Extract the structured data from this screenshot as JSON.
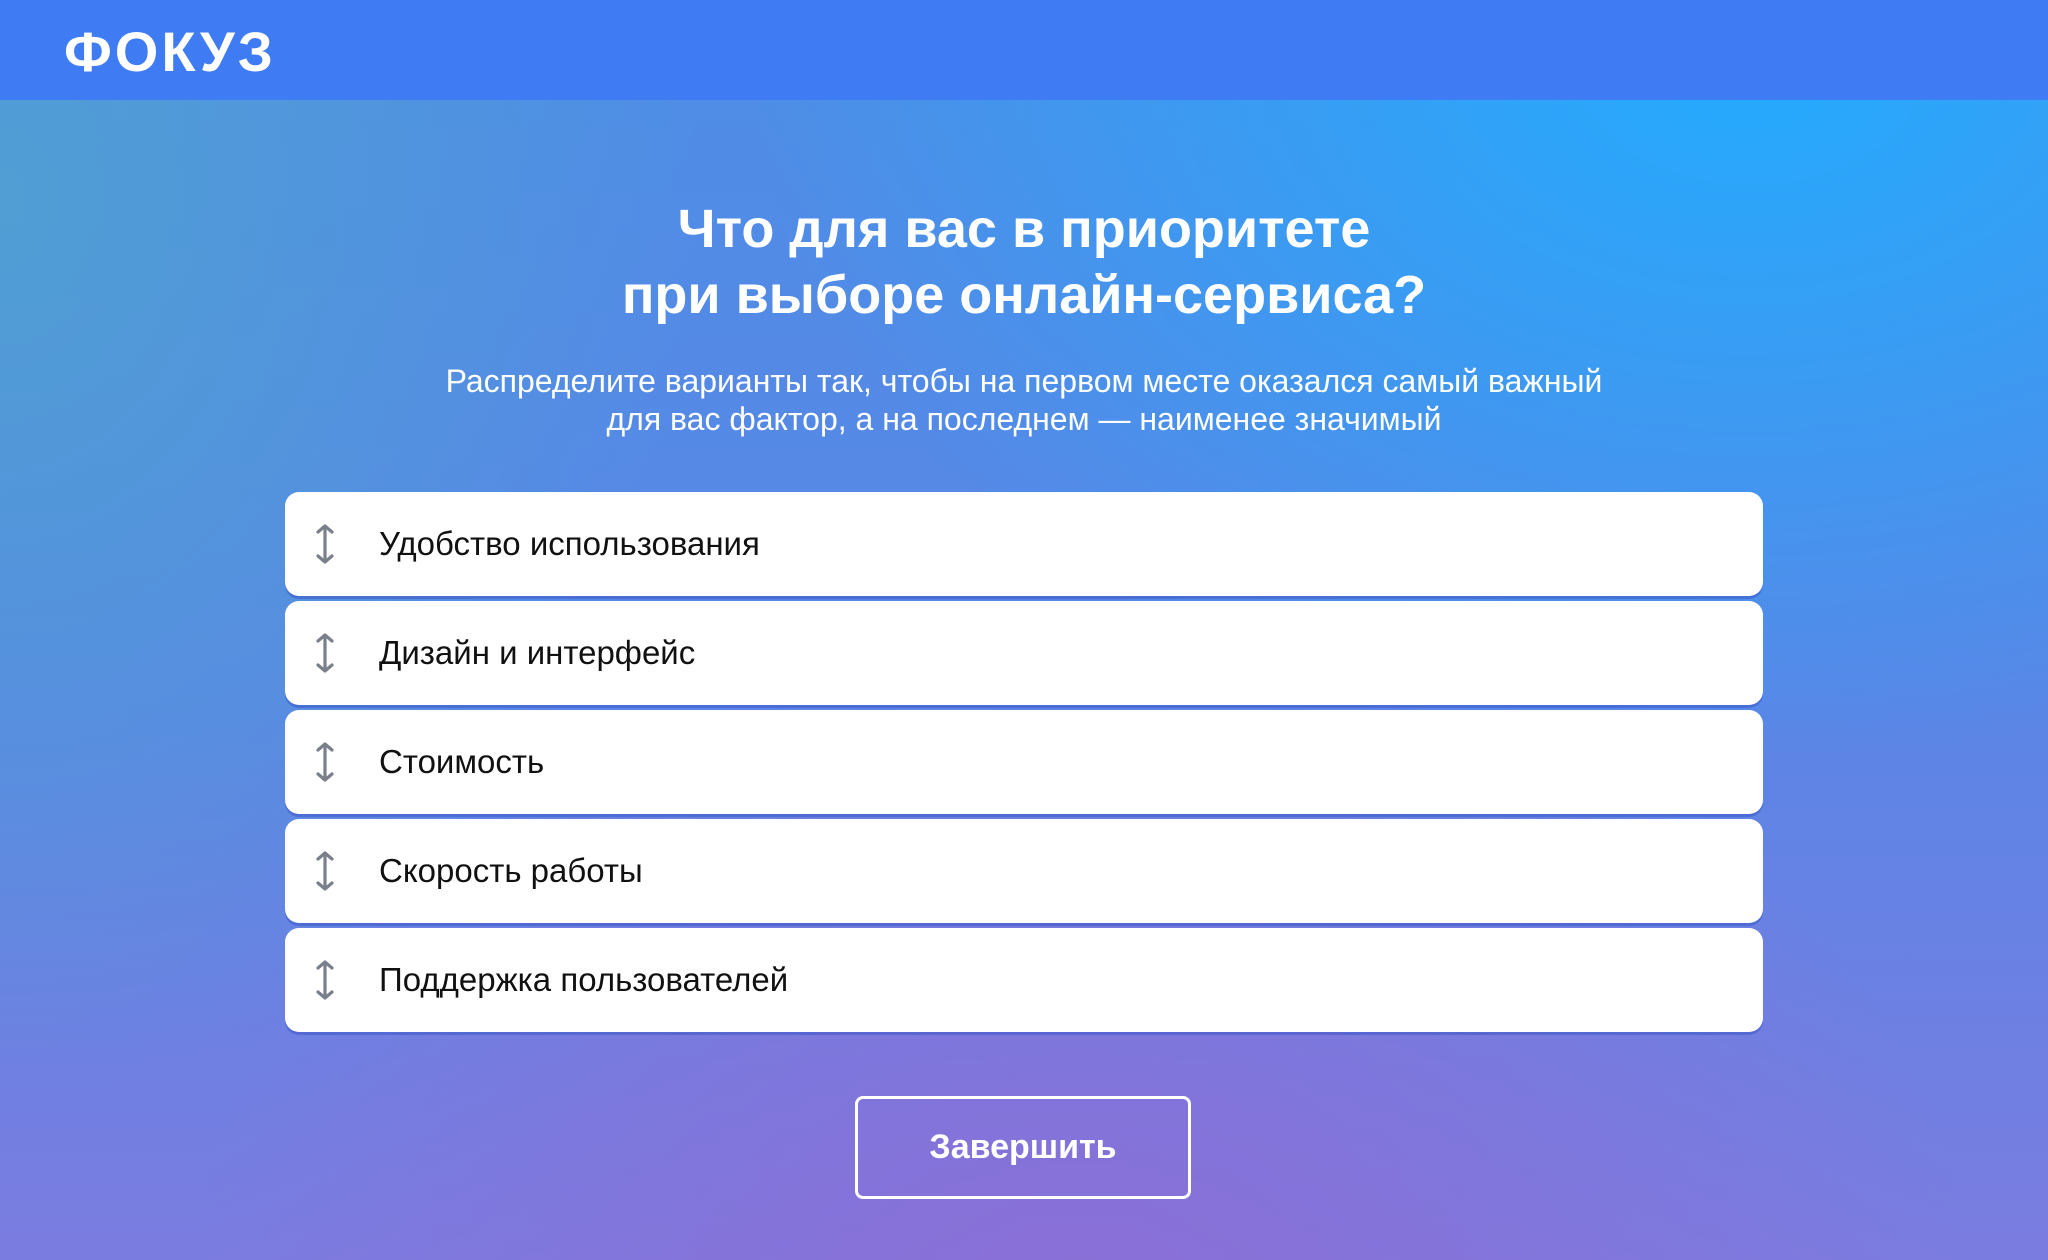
{
  "brand": {
    "logo_text": "ФОКУЗ",
    "header_color": "#3f7cf3"
  },
  "question": {
    "title_line1": "Что для вас в приоритете",
    "title_line2": "при выборе онлайн-сервиса?",
    "subtitle_line1": "Распределите варианты так, чтобы на первом месте оказался самый важный",
    "subtitle_line2": "для вас фактор, а на последнем — наименее значимый"
  },
  "options": [
    {
      "label": "Удобство использования",
      "icon": "drag-vertical-icon"
    },
    {
      "label": "Дизайн и интерфейс",
      "icon": "drag-vertical-icon"
    },
    {
      "label": "Стоимость",
      "icon": "drag-vertical-icon"
    },
    {
      "label": "Скорость работы",
      "icon": "drag-vertical-icon"
    },
    {
      "label": "Поддержка пользователей",
      "icon": "drag-vertical-icon"
    }
  ],
  "actions": {
    "finish_label": "Завершить"
  },
  "colors": {
    "icon": "#7a7f8c",
    "option_text": "#111111",
    "text_on_bg": "#ffffff"
  }
}
